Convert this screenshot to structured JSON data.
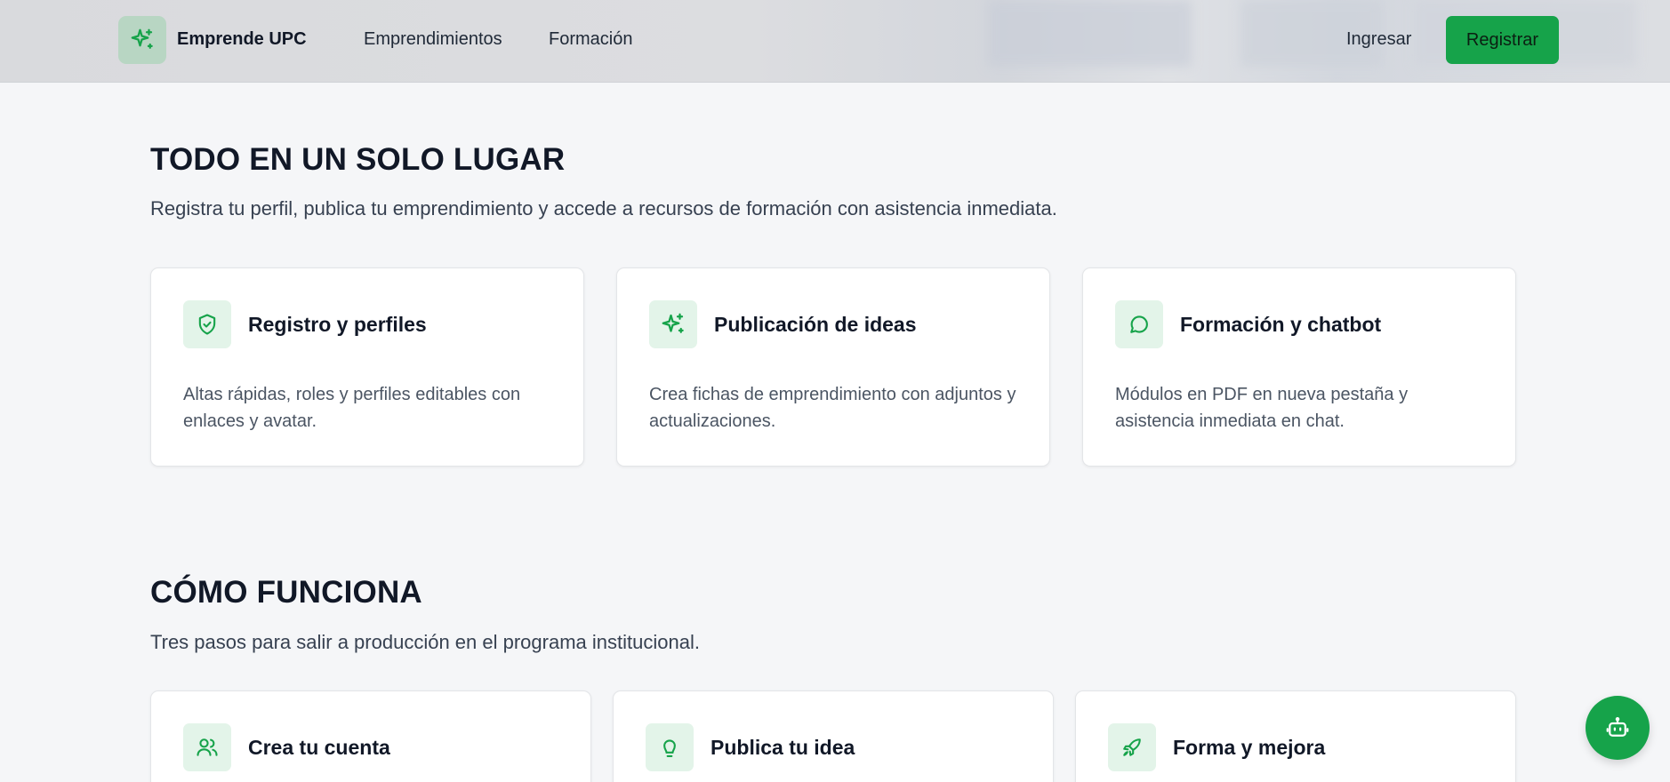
{
  "header": {
    "brand": "Emprende UPC",
    "nav": [
      {
        "label": "Emprendimientos"
      },
      {
        "label": "Formación"
      }
    ],
    "login_label": "Ingresar",
    "register_label": "Registrar"
  },
  "features": {
    "title": "TODO EN UN SOLO LUGAR",
    "subtitle": "Registra tu perfil, publica tu emprendimiento y accede a recursos de formación con asistencia inmediata.",
    "cards": [
      {
        "icon": "shield-check-icon",
        "title": "Registro y perfiles",
        "description": "Altas rápidas, roles y perfiles editables con enlaces y avatar."
      },
      {
        "icon": "sparkles-icon",
        "title": "Publicación de ideas",
        "description": "Crea fichas de emprendimiento con adjuntos y actualizaciones."
      },
      {
        "icon": "chat-bubble-icon",
        "title": "Formación y chatbot",
        "description": "Módulos en PDF en nueva pestaña y asistencia inmediata en chat."
      }
    ]
  },
  "how": {
    "title": "CÓMO FUNCIONA",
    "subtitle": "Tres pasos para salir a producción en el programa institucional.",
    "steps": [
      {
        "icon": "users-icon",
        "title": "Crea tu cuenta"
      },
      {
        "icon": "lightbulb-icon",
        "title": "Publica tu idea"
      },
      {
        "icon": "rocket-icon",
        "title": "Forma y mejora"
      }
    ]
  },
  "colors": {
    "accent": "#16a34a",
    "icon_bg": "#e3f4e9",
    "page_bg": "#f5f6f8"
  }
}
